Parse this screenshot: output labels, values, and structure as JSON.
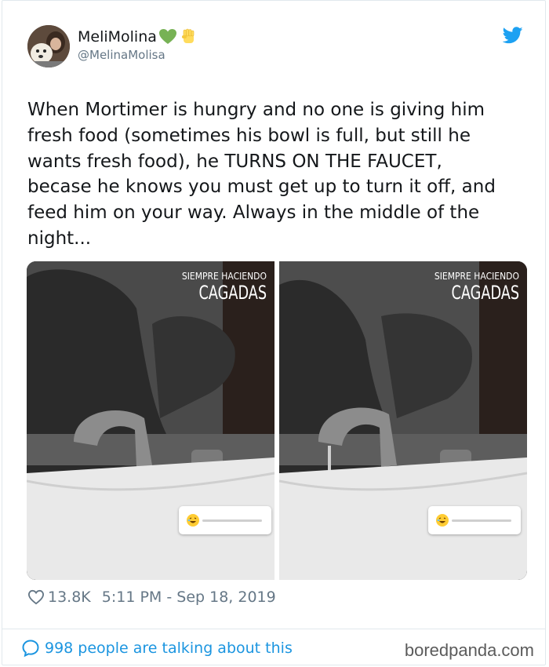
{
  "user": {
    "display_name": "MeliMolina",
    "handle": "@MelinaMolisa",
    "badges": [
      "green-heart-icon",
      "raised-fist-icon"
    ]
  },
  "tweet": {
    "text": "When Mortimer is hungry and no one is giving him\nfresh food (sometimes his bowl is full, but still he\nwants fresh food), he TURNS ON THE FAUCET,\nbecase he knows you must get up to turn it off, and\nfeed him on your way. Always in the middle of the\nnight..."
  },
  "media": [
    {
      "caption_small": "SIEMPRE HACIENDO",
      "caption_big": "CAGADAS"
    },
    {
      "caption_small": "SIEMPRE HACIENDO",
      "caption_big": "CAGADAS"
    }
  ],
  "meta": {
    "likes": "13.8K",
    "timestamp": "5:11 PM - Sep 18, 2019"
  },
  "footer": {
    "talking": "998 people are talking about this",
    "brand": "boredpanda.com"
  },
  "colors": {
    "link": "#1b95e0",
    "muted": "#657786",
    "twitter_blue": "#1da1f2"
  }
}
